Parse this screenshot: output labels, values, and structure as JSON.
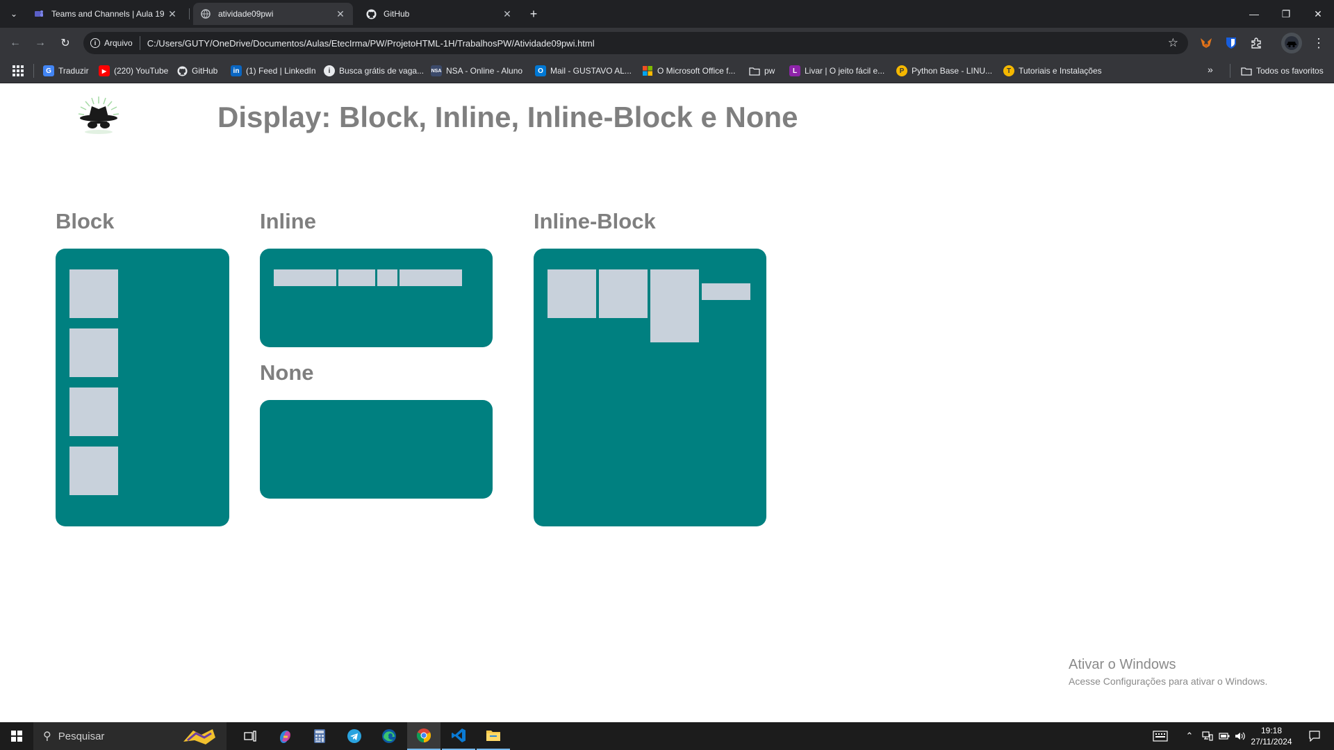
{
  "browser": {
    "tabs": [
      {
        "title": "Teams and Channels | Aula 19 -",
        "icon": "teams-icon",
        "active": false
      },
      {
        "title": "atividade09pwi",
        "icon": "globe-icon",
        "active": true
      },
      {
        "title": "GitHub",
        "icon": "github-icon",
        "active": false
      }
    ],
    "site_chip": "Arquivo",
    "url": "C:/Users/GUTY/OneDrive/Documentos/Aulas/EtecIrma/PW/ProjetoHTML-1H/TrabalhosPW/Atividade09pwi.html",
    "bookmarks": [
      {
        "label": "Traduzir",
        "icon": "translate-icon",
        "color": "#4285f4"
      },
      {
        "label": "(220) YouTube",
        "icon": "youtube-icon",
        "color": "#ff0000"
      },
      {
        "label": "GitHub",
        "icon": "github-icon",
        "color": "#35363a"
      },
      {
        "label": "(1) Feed | LinkedIn",
        "icon": "linkedin-icon",
        "color": "#0a66c2"
      },
      {
        "label": "Busca grátis de vaga...",
        "icon": "info-icon",
        "color": "#e8eaed"
      },
      {
        "label": "NSA - Online - Aluno",
        "icon": "nsa-icon",
        "color": "#3c4a6b"
      },
      {
        "label": "Mail - GUSTAVO AL...",
        "icon": "outlook-icon",
        "color": "#0078d4"
      },
      {
        "label": "O Microsoft Office f...",
        "icon": "microsoft-icon",
        "color": "#f25022"
      },
      {
        "label": "pw",
        "icon": "folder-icon",
        "color": "#35363a"
      },
      {
        "label": "Livar | O jeito fácil e...",
        "icon": "livar-icon",
        "color": "#8e24aa"
      },
      {
        "label": "Python Base - LINU...",
        "icon": "python-icon",
        "color": "#f5b800"
      },
      {
        "label": "Tutoriais e Instalações",
        "icon": "tutorial-icon",
        "color": "#f5b800"
      }
    ],
    "all_bookmarks": "Todos os favoritos"
  },
  "page": {
    "title": "Display: Block, Inline, Inline-Block e None",
    "sections": {
      "block": "Block",
      "inline": "Inline",
      "none": "None",
      "inline_block": "Inline-Block"
    },
    "colors": {
      "panel": "#008080",
      "box": "#c8d1db",
      "heading": "#7f7f7f"
    }
  },
  "watermark": {
    "line1": "Ativar o Windows",
    "line2": "Acesse Configurações para ativar o Windows."
  },
  "taskbar": {
    "search_placeholder": "Pesquisar",
    "time": "19:18",
    "date": "27/11/2024"
  }
}
